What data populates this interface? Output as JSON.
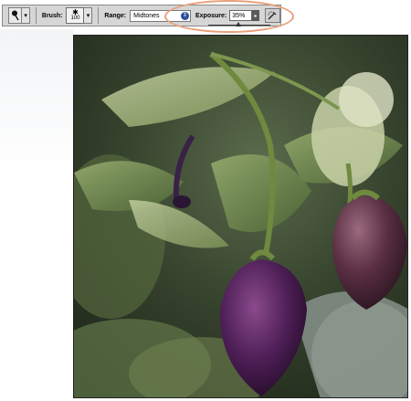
{
  "toolbar": {
    "brush_label": "Brush:",
    "brush_size": "100",
    "range_label": "Range:",
    "range_value": "Midtones",
    "exposure_label": "Exposure:",
    "exposure_value": "35%",
    "tool_icon": "dodge-tool-icon",
    "airbrush_icon": "airbrush-icon"
  },
  "colors": {
    "highlight": "#e9a07a",
    "toolbar_bg": "#d6d6d6"
  },
  "image": {
    "subject": "purple pepper plant photo"
  }
}
